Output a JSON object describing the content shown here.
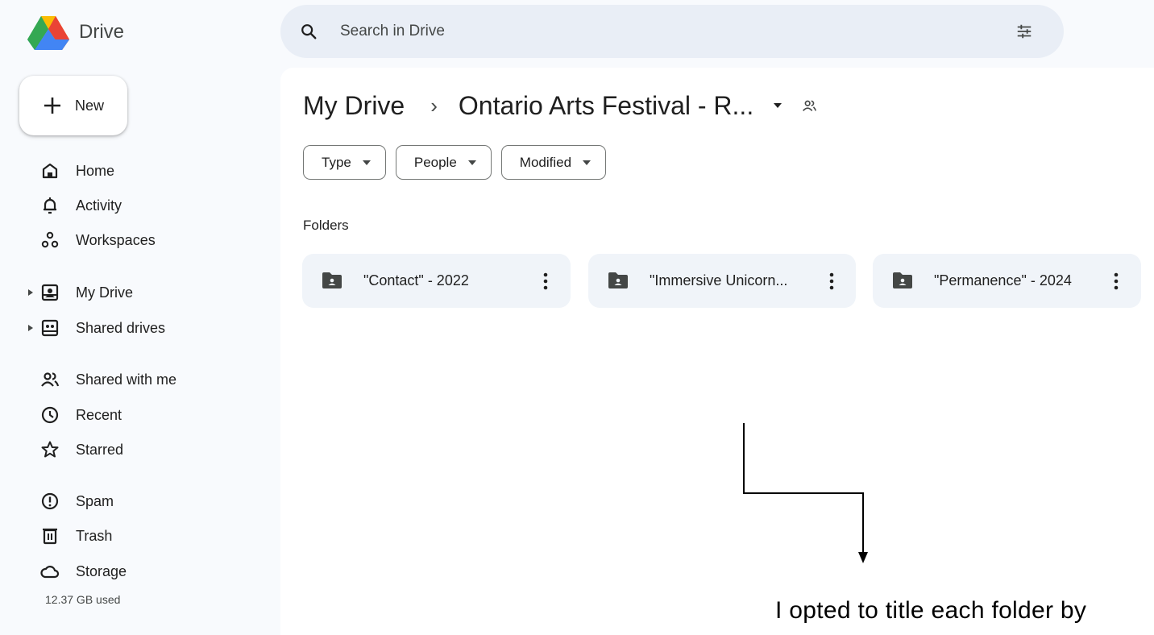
{
  "app": {
    "name": "Drive"
  },
  "search": {
    "placeholder": "Search in Drive"
  },
  "sidebar": {
    "new_label": "New",
    "items": [
      {
        "label": "Home",
        "icon": "home-icon"
      },
      {
        "label": "Activity",
        "icon": "bell-icon"
      },
      {
        "label": "Workspaces",
        "icon": "workspaces-icon"
      },
      {
        "label": "My Drive",
        "icon": "my-drive-icon"
      },
      {
        "label": "Shared drives",
        "icon": "shared-drives-icon"
      },
      {
        "label": "Shared with me",
        "icon": "people-icon"
      },
      {
        "label": "Recent",
        "icon": "clock-icon"
      },
      {
        "label": "Starred",
        "icon": "star-icon"
      },
      {
        "label": "Spam",
        "icon": "spam-icon"
      },
      {
        "label": "Trash",
        "icon": "trash-icon"
      },
      {
        "label": "Storage",
        "icon": "cloud-icon"
      }
    ],
    "storage_used": "12.37 GB used"
  },
  "breadcrumb": {
    "root": "My Drive",
    "separator": "›",
    "current": "Ontario Arts Festival - R..."
  },
  "filters": [
    {
      "label": "Type"
    },
    {
      "label": "People"
    },
    {
      "label": "Modified"
    }
  ],
  "sections": {
    "folders_label": "Folders"
  },
  "folders": [
    {
      "name": "\"Contact\" - 2022"
    },
    {
      "name": "\"Immersive Unicorn..."
    },
    {
      "name": "\"Permanence\" - 2024"
    }
  ],
  "annotation": {
    "text": "I opted to title each folder by"
  },
  "colors": {
    "background": "#f8fafd",
    "search_bg": "#e9eef6",
    "folder_bg": "#f0f4f9",
    "text": "#1f1f1f",
    "icon": "#444746"
  }
}
